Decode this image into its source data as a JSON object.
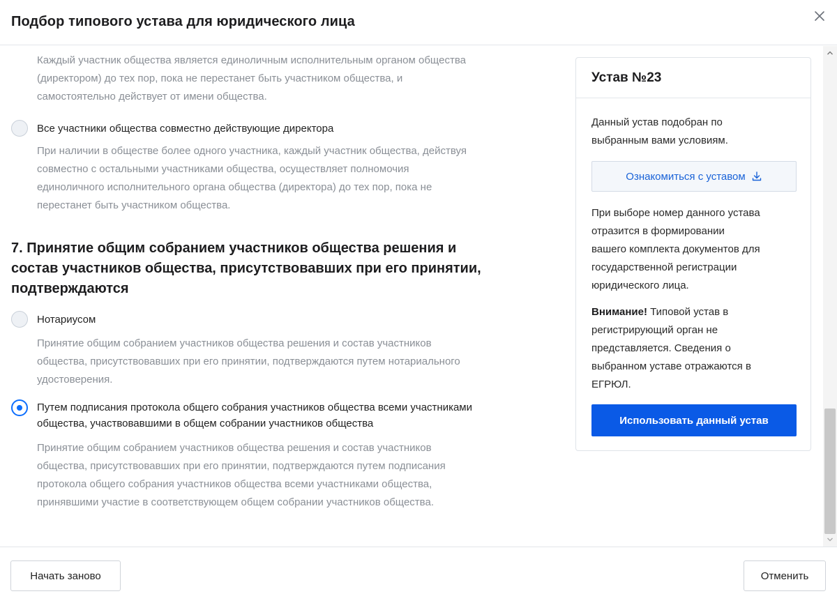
{
  "dialog": {
    "title": "Подбор типового устава для юридического лица"
  },
  "section6": {
    "option_top": {
      "desc_lines": [
        "Каждый участник общества является единоличным исполнительным органом общества",
        "(директором) до тех пор, пока не перестанет быть участником общества, и",
        "самостоятельно действует от имени общества."
      ]
    },
    "option_joint": {
      "label": "Все участники общества совместно действующие директора",
      "desc_lines": [
        "При наличии в обществе более одного участника, каждый участник общества, действуя",
        "совместно с остальными участниками общества, осуществляет полномочия",
        "единоличного исполнительного органа общества (директора) до тех пор, пока не",
        "перестанет быть участником общества."
      ]
    }
  },
  "section7": {
    "title_lines": [
      "7. Принятие общим собранием участников общества решения и",
      "состав участников общества, присутствовавших при его принятии,",
      "подтверждаются"
    ],
    "option_notary": {
      "label": "Нотариусом",
      "selected": false,
      "desc_lines": [
        "Принятие общим собранием участников общества решения и состав участников",
        "общества, присутствовавших при его принятии, подтверждаются путем нотариального",
        "удостоверения."
      ]
    },
    "option_protocol": {
      "label_lines": [
        "Путем подписания протокола общего собрания участников общества всеми участниками",
        "общества, участвовавшими в общем собрании участников общества"
      ],
      "selected": true,
      "desc_lines": [
        "Принятие общим собранием участников общества решения и состав участников",
        "общества, присутствовавших при его принятии, подтверждаются путем подписания",
        "протокола общего собрания участников общества всеми участниками общества,",
        "принявшими участие в соответствующем общем собрании участников общества."
      ]
    }
  },
  "card": {
    "title": "Устав №23",
    "intro_lines": [
      "Данный устав подобран по",
      "выбранным вами условиям."
    ],
    "view_button": "Ознакомиться с уставом",
    "info_lines": [
      "При выборе номер данного устава",
      "отразится в формировании",
      "вашего комплекта документов для",
      "государственной регистрации",
      "юридического лица."
    ],
    "warning_bold": "Внимание!",
    "warning_lines": [
      " Типовой устав в",
      "регистрирующий орган не",
      "представляется. Сведения о",
      "выбранном уставе отражаются в",
      "ЕГРЮЛ."
    ],
    "use_button": "Использовать данный устав"
  },
  "footer": {
    "restart_label": "Начать заново",
    "cancel_label": "Отменить"
  },
  "colors": {
    "primary": "#0a5ae6",
    "link": "#1a63d8",
    "muted_text": "#8a8f96"
  },
  "icons": {
    "close": "close-icon",
    "download": "download-icon",
    "radio": "radio-icon"
  }
}
